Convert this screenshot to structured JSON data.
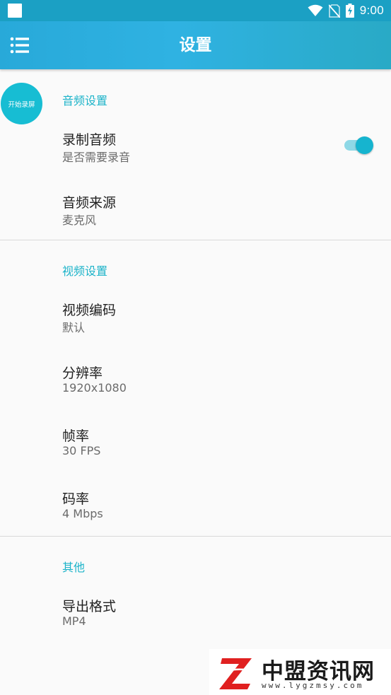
{
  "status_bar": {
    "time": "9:00"
  },
  "app_bar": {
    "title": "设置",
    "menu_icon": "list-menu-icon"
  },
  "fab": {
    "label": "开始录屏"
  },
  "sections": {
    "audio": {
      "header": "音频设置",
      "record_audio": {
        "title": "录制音频",
        "summary": "是否需要录音",
        "enabled": true
      },
      "audio_source": {
        "title": "音频来源",
        "summary": "麦克风"
      }
    },
    "video": {
      "header": "视频设置",
      "encoder": {
        "title": "视频编码",
        "summary": "默认"
      },
      "resolution": {
        "title": "分辨率",
        "summary": "1920x1080"
      },
      "frame_rate": {
        "title": "帧率",
        "summary": "30 FPS"
      },
      "bitrate": {
        "title": "码率",
        "summary": "4 Mbps"
      }
    },
    "other": {
      "header": "其他",
      "export_format": {
        "title": "导出格式",
        "summary": "MP4"
      }
    }
  },
  "watermark": {
    "title": "中盟资讯网",
    "url": "www.lygzmsy.com"
  },
  "colors": {
    "accent": "#17bdd3",
    "app_bar": "#2fb2e2",
    "status_bar": "#1ba0c4"
  }
}
